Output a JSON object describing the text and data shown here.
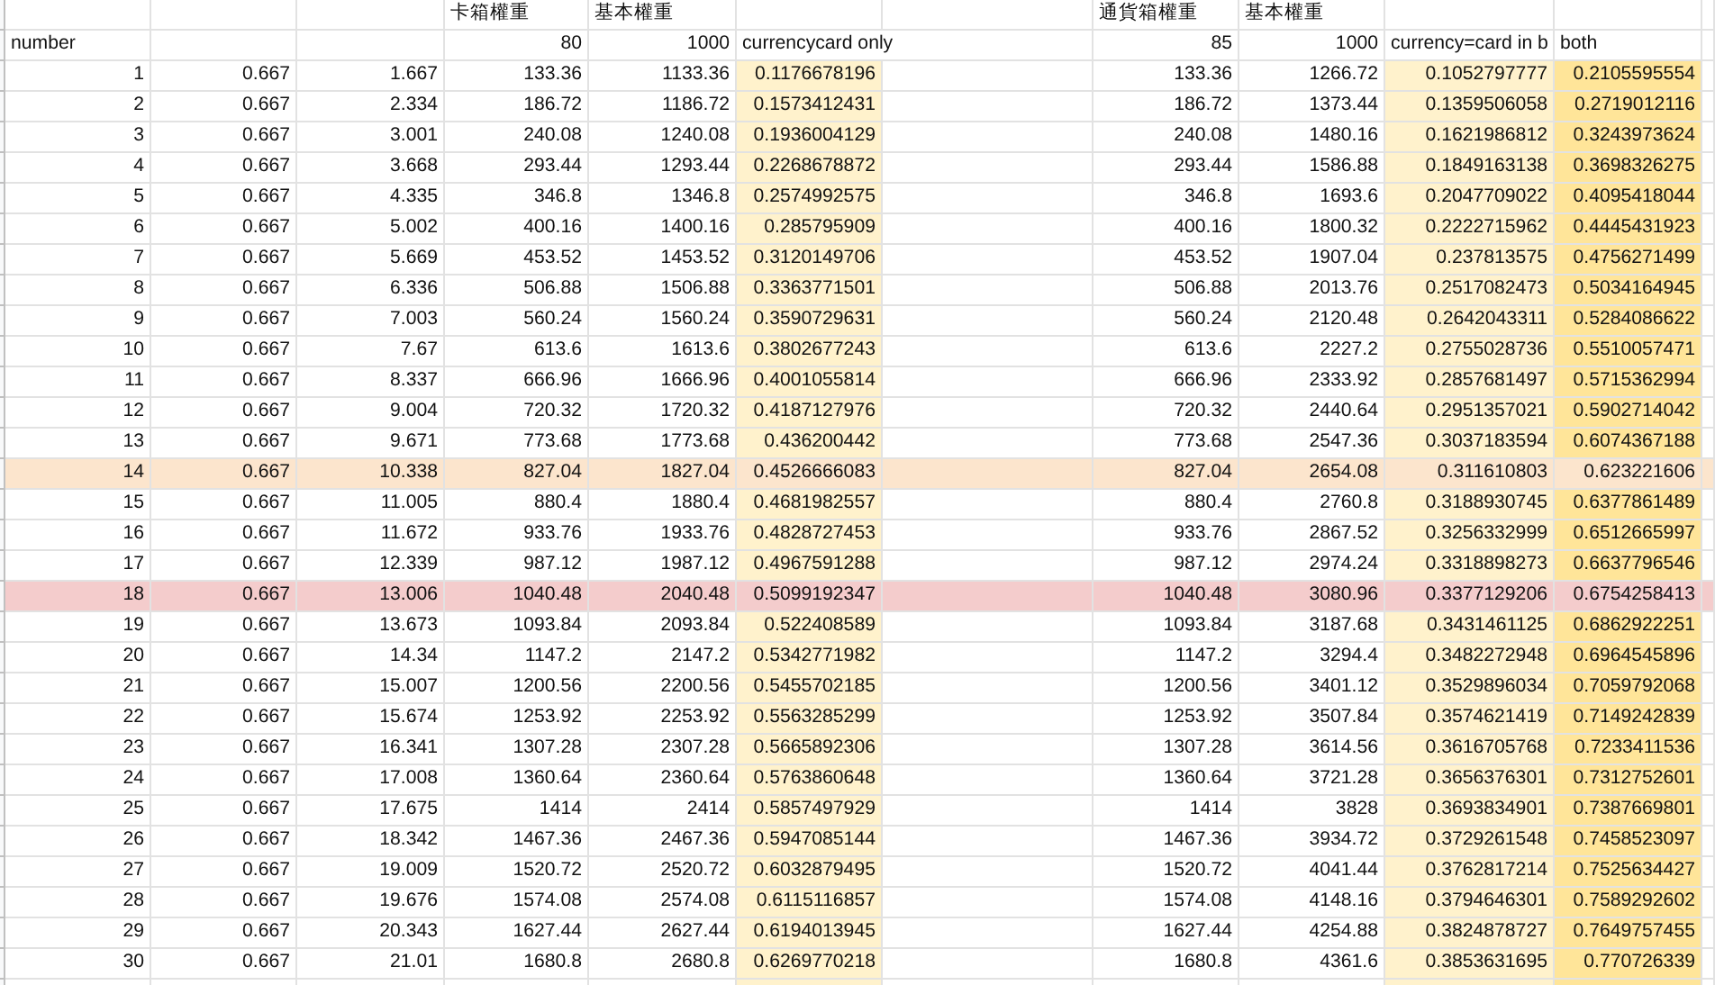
{
  "sheet": {
    "top_labels": {
      "card_box_weight": "卡箱權重",
      "base_weight": "基本權重",
      "currency_box_weight": "通貨箱權重",
      "base_weight_2": "基本權重"
    },
    "second_row": {
      "number_label": "number",
      "card_box_weight": "80",
      "base_weight": "1000",
      "currencycard_only": "currencycard only",
      "currency_box_weight": "85",
      "base_weight_2": "1000",
      "currency_card": "currency=card in b",
      "both": "both"
    },
    "rows": [
      {
        "cells": [
          "1",
          "0.667",
          "1.667",
          "133.36",
          "1133.36",
          "0.1176678196",
          "133.36",
          "1266.72",
          "0.1052797777",
          "0.2105595554"
        ]
      },
      {
        "cells": [
          "2",
          "0.667",
          "2.334",
          "186.72",
          "1186.72",
          "0.1573412431",
          "186.72",
          "1373.44",
          "0.1359506058",
          "0.2719012116"
        ]
      },
      {
        "cells": [
          "3",
          "0.667",
          "3.001",
          "240.08",
          "1240.08",
          "0.1936004129",
          "240.08",
          "1480.16",
          "0.1621986812",
          "0.3243973624"
        ]
      },
      {
        "cells": [
          "4",
          "0.667",
          "3.668",
          "293.44",
          "1293.44",
          "0.2268678872",
          "293.44",
          "1586.88",
          "0.1849163138",
          "0.3698326275"
        ]
      },
      {
        "cells": [
          "5",
          "0.667",
          "4.335",
          "346.8",
          "1346.8",
          "0.2574992575",
          "346.8",
          "1693.6",
          "0.2047709022",
          "0.4095418044"
        ]
      },
      {
        "cells": [
          "6",
          "0.667",
          "5.002",
          "400.16",
          "1400.16",
          "0.285795909",
          "400.16",
          "1800.32",
          "0.2222715962",
          "0.4445431923"
        ]
      },
      {
        "cells": [
          "7",
          "0.667",
          "5.669",
          "453.52",
          "1453.52",
          "0.3120149706",
          "453.52",
          "1907.04",
          "0.237813575",
          "0.4756271499"
        ]
      },
      {
        "cells": [
          "8",
          "0.667",
          "6.336",
          "506.88",
          "1506.88",
          "0.3363771501",
          "506.88",
          "2013.76",
          "0.2517082473",
          "0.5034164945"
        ]
      },
      {
        "cells": [
          "9",
          "0.667",
          "7.003",
          "560.24",
          "1560.24",
          "0.3590729631",
          "560.24",
          "2120.48",
          "0.2642043311",
          "0.5284086622"
        ]
      },
      {
        "cells": [
          "10",
          "0.667",
          "7.67",
          "613.6",
          "1613.6",
          "0.3802677243",
          "613.6",
          "2227.2",
          "0.2755028736",
          "0.5510057471"
        ]
      },
      {
        "cells": [
          "11",
          "0.667",
          "8.337",
          "666.96",
          "1666.96",
          "0.4001055814",
          "666.96",
          "2333.92",
          "0.2857681497",
          "0.5715362994"
        ]
      },
      {
        "cells": [
          "12",
          "0.667",
          "9.004",
          "720.32",
          "1720.32",
          "0.4187127976",
          "720.32",
          "2440.64",
          "0.2951357021",
          "0.5902714042"
        ]
      },
      {
        "cells": [
          "13",
          "0.667",
          "9.671",
          "773.68",
          "1773.68",
          "0.436200442",
          "773.68",
          "2547.36",
          "0.3037183594",
          "0.6074367188"
        ]
      },
      {
        "cells": [
          "14",
          "0.667",
          "10.338",
          "827.04",
          "1827.04",
          "0.4526666083",
          "827.04",
          "2654.08",
          "0.311610803",
          "0.623221606"
        ],
        "color": "#fce5cd"
      },
      {
        "cells": [
          "15",
          "0.667",
          "11.005",
          "880.4",
          "1880.4",
          "0.4681982557",
          "880.4",
          "2760.8",
          "0.3188930745",
          "0.6377861489"
        ]
      },
      {
        "cells": [
          "16",
          "0.667",
          "11.672",
          "933.76",
          "1933.76",
          "0.4828727453",
          "933.76",
          "2867.52",
          "0.3256332999",
          "0.6512665997"
        ]
      },
      {
        "cells": [
          "17",
          "0.667",
          "12.339",
          "987.12",
          "1987.12",
          "0.4967591288",
          "987.12",
          "2974.24",
          "0.3318898273",
          "0.6637796546"
        ]
      },
      {
        "cells": [
          "18",
          "0.667",
          "13.006",
          "1040.48",
          "2040.48",
          "0.5099192347",
          "1040.48",
          "3080.96",
          "0.3377129206",
          "0.6754258413"
        ],
        "color": "#f4cccc"
      },
      {
        "cells": [
          "19",
          "0.667",
          "13.673",
          "1093.84",
          "2093.84",
          "0.522408589",
          "1093.84",
          "3187.68",
          "0.3431461125",
          "0.6862922251"
        ]
      },
      {
        "cells": [
          "20",
          "0.667",
          "14.34",
          "1147.2",
          "2147.2",
          "0.5342771982",
          "1147.2",
          "3294.4",
          "0.3482272948",
          "0.6964545896"
        ]
      },
      {
        "cells": [
          "21",
          "0.667",
          "15.007",
          "1200.56",
          "2200.56",
          "0.5455702185",
          "1200.56",
          "3401.12",
          "0.3529896034",
          "0.7059792068"
        ]
      },
      {
        "cells": [
          "22",
          "0.667",
          "15.674",
          "1253.92",
          "2253.92",
          "0.5563285299",
          "1253.92",
          "3507.84",
          "0.3574621419",
          "0.7149242839"
        ]
      },
      {
        "cells": [
          "23",
          "0.667",
          "16.341",
          "1307.28",
          "2307.28",
          "0.5665892306",
          "1307.28",
          "3614.56",
          "0.3616705768",
          "0.7233411536"
        ]
      },
      {
        "cells": [
          "24",
          "0.667",
          "17.008",
          "1360.64",
          "2360.64",
          "0.5763860648",
          "1360.64",
          "3721.28",
          "0.3656376301",
          "0.7312752601"
        ]
      },
      {
        "cells": [
          "25",
          "0.667",
          "17.675",
          "1414",
          "2414",
          "0.5857497929",
          "1414",
          "3828",
          "0.3693834901",
          "0.7387669801"
        ]
      },
      {
        "cells": [
          "26",
          "0.667",
          "18.342",
          "1467.36",
          "2467.36",
          "0.5947085144",
          "1467.36",
          "3934.72",
          "0.3729261548",
          "0.7458523097"
        ]
      },
      {
        "cells": [
          "27",
          "0.667",
          "19.009",
          "1520.72",
          "2520.72",
          "0.6032879495",
          "1520.72",
          "4041.44",
          "0.3762817214",
          "0.7525634427"
        ]
      },
      {
        "cells": [
          "28",
          "0.667",
          "19.676",
          "1574.08",
          "2574.08",
          "0.6115116857",
          "1574.08",
          "4148.16",
          "0.3794646301",
          "0.7589292602"
        ]
      },
      {
        "cells": [
          "29",
          "0.667",
          "20.343",
          "1627.44",
          "2627.44",
          "0.6194013945",
          "1627.44",
          "4254.88",
          "0.3824878727",
          "0.7649757455"
        ]
      },
      {
        "cells": [
          "30",
          "0.667",
          "21.01",
          "1680.8",
          "2680.8",
          "0.6269770218",
          "1680.8",
          "4361.6",
          "0.3853631695",
          "0.770726339"
        ]
      }
    ]
  }
}
